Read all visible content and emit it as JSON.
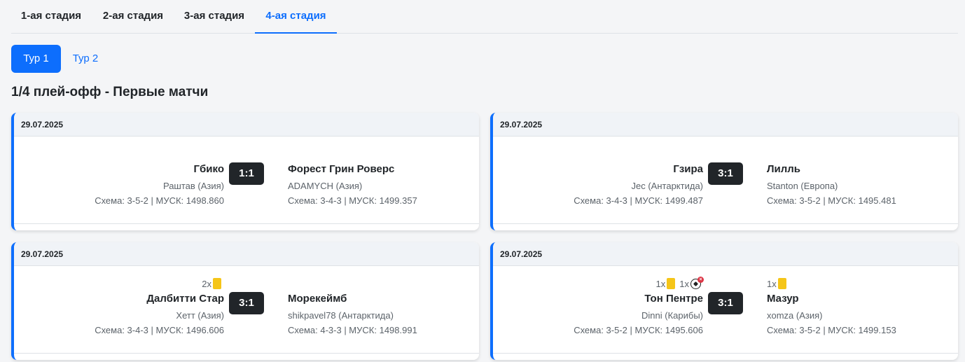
{
  "stage_tabs": [
    {
      "label": "1-ая стадия",
      "active": false
    },
    {
      "label": "2-ая стадия",
      "active": false
    },
    {
      "label": "3-ая стадия",
      "active": false
    },
    {
      "label": "4-ая стадия",
      "active": true
    }
  ],
  "round_tabs": [
    {
      "label": "Тур 1",
      "active": true
    },
    {
      "label": "Тур 2",
      "active": false
    }
  ],
  "section_title": "1/4 плей-офф - Первые матчи",
  "matches": [
    {
      "date": "29.07.2025",
      "score": "1:1",
      "home": {
        "team": "Гбико",
        "manager": "Раштав (Азия)",
        "scheme": "Схема: 3-5-2 | МУСК: 1498.860",
        "events": []
      },
      "away": {
        "team": "Форест Грин Роверс",
        "manager": "ADAMYCH (Азия)",
        "scheme": "Схема: 3-4-3 | МУСК: 1499.357",
        "events": []
      }
    },
    {
      "date": "29.07.2025",
      "score": "3:1",
      "home": {
        "team": "Гзира",
        "manager": "Jec (Антарктида)",
        "scheme": "Схема: 3-4-3 | МУСК: 1499.487",
        "events": []
      },
      "away": {
        "team": "Лилль",
        "manager": "Stanton (Европа)",
        "scheme": "Схема: 3-5-2 | МУСК: 1495.481",
        "events": []
      }
    },
    {
      "date": "29.07.2025",
      "score": "3:1",
      "home": {
        "team": "Далбитти Стар",
        "manager": "Хетт (Азия)",
        "scheme": "Схема: 3-4-3 | МУСК: 1496.606",
        "events": [
          {
            "count": "2x",
            "icon": "yellow-card-icon"
          }
        ]
      },
      "away": {
        "team": "Морекеймб",
        "manager": "shikpavel78 (Антарктида)",
        "scheme": "Схема: 4-3-3 | МУСК: 1498.991",
        "events": []
      }
    },
    {
      "date": "29.07.2025",
      "score": "3:1",
      "home": {
        "team": "Тон Пентре",
        "manager": "Dinni (Карибы)",
        "scheme": "Схема: 3-5-2 | МУСК: 1495.606",
        "events": [
          {
            "count": "1x",
            "icon": "yellow-card-icon"
          },
          {
            "count": "1x",
            "icon": "missed-penalty-icon"
          }
        ]
      },
      "away": {
        "team": "Мазур",
        "manager": "xomza (Азия)",
        "scheme": "Схема: 3-5-2 | МУСК: 1499.153",
        "events": [
          {
            "count": "1x",
            "icon": "yellow-card-icon"
          }
        ]
      }
    }
  ],
  "colors": {
    "accent": "#0d6efd",
    "score_bg": "#212529",
    "yellow_card": "#f5c518",
    "red_mark": "#dc3545"
  }
}
